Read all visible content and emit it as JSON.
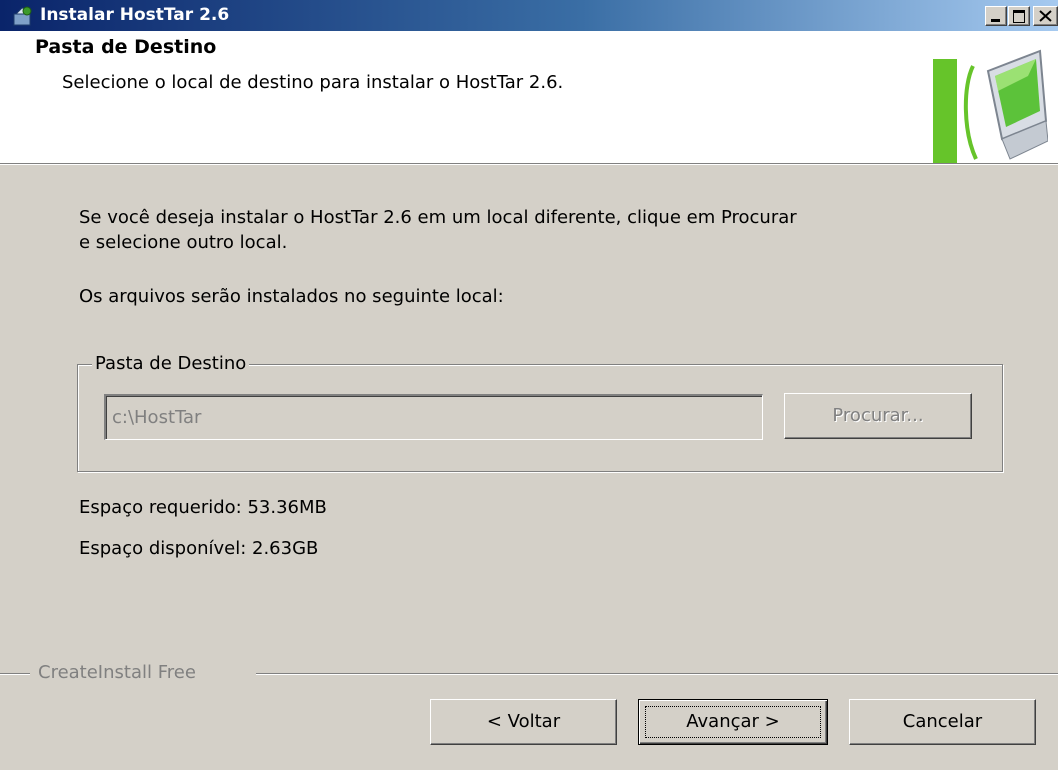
{
  "window": {
    "title": "Instalar HostTar 2.6",
    "controls": [
      "minimize-icon",
      "maximize-icon",
      "close-icon"
    ]
  },
  "header": {
    "title": "Pasta de Destino",
    "subtitle": "Selecione o local de destino para instalar o HostTar 2.6.",
    "logo_icon": "computer-monitor-icon"
  },
  "body": {
    "instruction_line1": "Se você deseja instalar o HostTar 2.6 em um local diferente, clique em Procurar",
    "instruction_line2": "e selecione outro local.",
    "instruction_files": "Os arquivos serão instalados no seguinte local:",
    "group_label": "Pasta de Destino",
    "path_value": "c:\\HostTar",
    "browse_label": "Procurar...",
    "space_required": "Espaço requerido: 53.36MB",
    "space_available": "Espaço disponível: 2.63GB"
  },
  "footer": {
    "branding": "CreateInstall Free",
    "back_label": "< Voltar",
    "next_label": "Avançar >",
    "cancel_label": "Cancelar"
  },
  "colors": {
    "titlebar_start": "#0a246a",
    "titlebar_end": "#a6caf0",
    "dialog_bg": "#d4d0c8",
    "logo_green": "#66c42a"
  }
}
